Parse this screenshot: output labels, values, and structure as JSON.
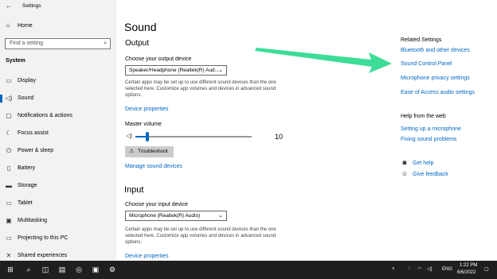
{
  "window": {
    "title": "Settings",
    "controls": {
      "minimize": "–",
      "maximize": "☐",
      "close": "✕"
    }
  },
  "sidebar": {
    "home": "Home",
    "search_placeholder": "Find a setting",
    "section": "System",
    "items": [
      {
        "label": "Display",
        "icon": "display-icon"
      },
      {
        "label": "Sound",
        "icon": "speaker-icon",
        "selected": true
      },
      {
        "label": "Notifications & actions",
        "icon": "notification-icon"
      },
      {
        "label": "Focus assist",
        "icon": "moon-icon"
      },
      {
        "label": "Power & sleep",
        "icon": "power-icon"
      },
      {
        "label": "Battery",
        "icon": "battery-icon"
      },
      {
        "label": "Storage",
        "icon": "storage-icon"
      },
      {
        "label": "Tablet",
        "icon": "tablet-icon"
      },
      {
        "label": "Multitasking",
        "icon": "multitasking-icon"
      },
      {
        "label": "Projecting to this PC",
        "icon": "projector-icon"
      },
      {
        "label": "Shared experiences",
        "icon": "shared-experiences-icon"
      }
    ]
  },
  "main": {
    "title": "Sound",
    "output": {
      "heading": "Output",
      "device_label": "Choose your output device",
      "device_value": "Speaker/Headphone (Realtek(R) Aud...",
      "note": "Certain apps may be set up to use different sound devices than the one selected here. Customize app volumes and devices in advanced sound options.",
      "note_lines": [
        "Certain apps may be set up to use different sound devices than the one",
        "selected here. Customize app volumes and devices in advanced sound",
        "options."
      ],
      "properties_link": "Device properties",
      "volume_label": "Master volume",
      "volume_value": "10",
      "volume_fraction": 0.1,
      "troubleshoot": "Troubleshoot",
      "manage_link": "Manage sound devices"
    },
    "input": {
      "heading": "Input",
      "device_label": "Choose your input device",
      "device_value": "Microphone (Realtek(R) Audio)",
      "note_lines": [
        "Certain apps may be set up to use different sound devices than the one",
        "selected here. Customize app volumes and devices in advanced sound",
        "options."
      ],
      "properties_link": "Device properties"
    }
  },
  "related": {
    "heading": "Related Settings",
    "links": [
      "Bluetooth and other devices",
      "Sound Control Panel",
      "Microphone privacy settings",
      "Ease of Access audio settings"
    ]
  },
  "help": {
    "heading": "Help from the web",
    "links": [
      "Setting up a microphone",
      "Fixing sound problems"
    ],
    "get_help": "Get help",
    "give_feedback": "Give feedback"
  },
  "taskbar": {
    "language": "ENG",
    "time": "1:22 PM",
    "date": "6/6/2022"
  },
  "colors": {
    "accent": "#0067c0",
    "arrow": "#3ddc97",
    "sidebar_bg": "#f2f2f2",
    "taskbar_bg": "#1f1f1f"
  }
}
